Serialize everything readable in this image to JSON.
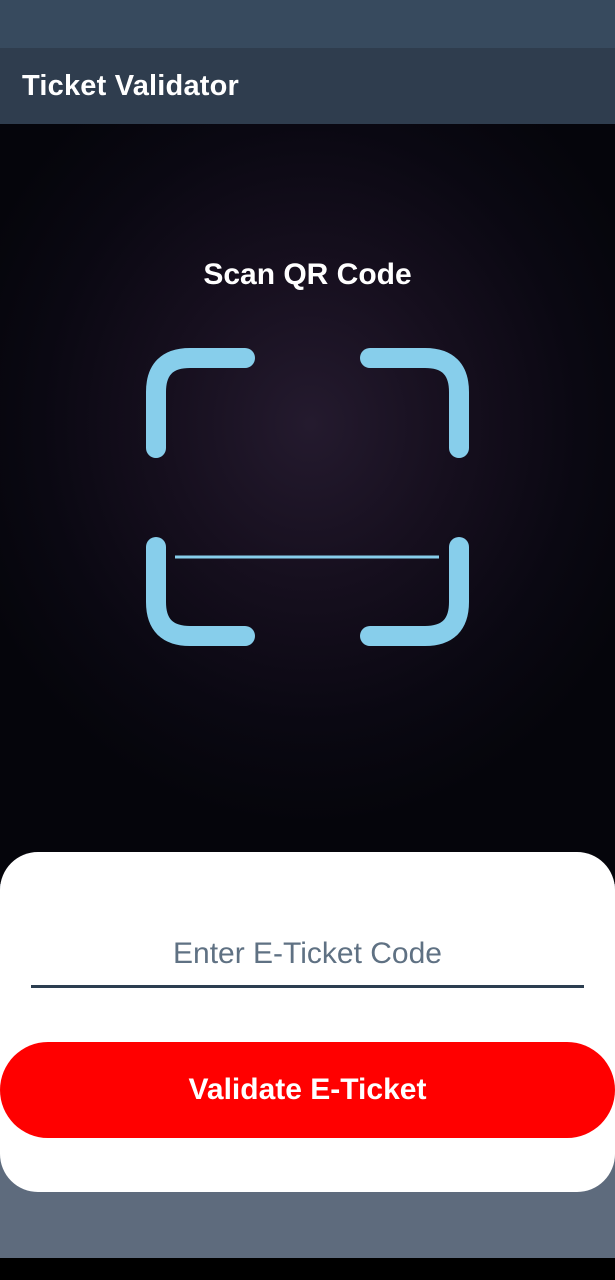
{
  "app": {
    "title": "Ticket Validator"
  },
  "scanner": {
    "title": "Scan QR Code",
    "frame_color": "#87ceeb",
    "icon": "qr-scan-frame-icon"
  },
  "ticket_form": {
    "input_value": "",
    "input_placeholder": "Enter E-Ticket Code",
    "validate_label": "Validate E-Ticket",
    "button_color": "#ff0000"
  }
}
